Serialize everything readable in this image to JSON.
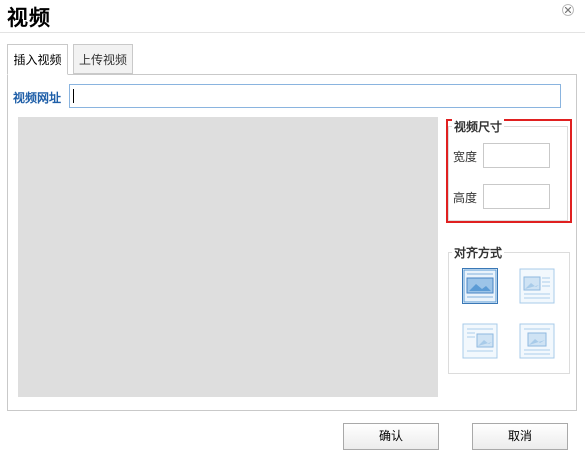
{
  "dialog": {
    "title": "视频"
  },
  "tabs": [
    {
      "label": "插入视频",
      "active": true
    },
    {
      "label": "上传视频",
      "active": false
    }
  ],
  "url": {
    "label": "视频网址",
    "value": ""
  },
  "size": {
    "legend": "视频尺寸",
    "width_label": "宽度",
    "width_value": "",
    "height_label": "高度",
    "height_value": ""
  },
  "align": {
    "legend": "对齐方式",
    "options": [
      "none",
      "left",
      "right",
      "center"
    ],
    "selected": "none"
  },
  "buttons": {
    "confirm": "确认",
    "cancel": "取消"
  },
  "colors": {
    "highlight_border": "#e02020",
    "label_blue": "#1f5fa8",
    "preview_bg": "#dedede"
  }
}
